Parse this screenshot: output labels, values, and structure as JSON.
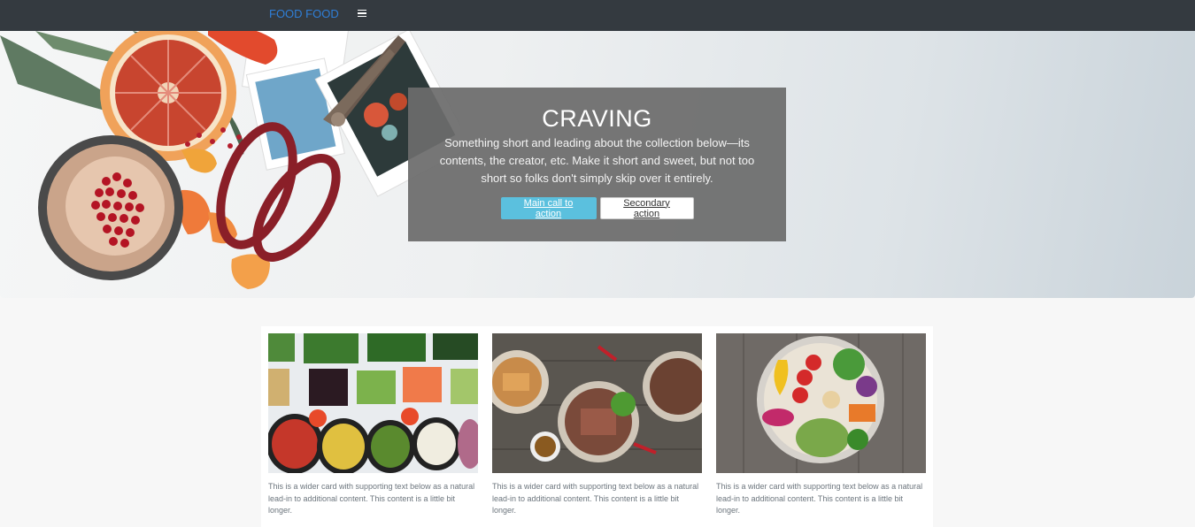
{
  "navbar": {
    "brand": "FOOD FOOD",
    "menu_icon": "hamburger-menu-icon",
    "background": "#343a40",
    "brand_color": "#2f7fd8"
  },
  "hero": {
    "title": "CRAVING",
    "lead": "Something short and leading about the collection below—its contents, the creator, etc. Make it short and sweet, but not too short so folks don't simply skip over it entirely.",
    "primary_button": "Main call to action",
    "secondary_button": "Secondary action",
    "primary_color": "#5bc0de"
  },
  "cards": [
    {
      "image": "salad-bar-photo",
      "text": "This is a wider card with supporting text below as a natural lead-in to additional content. This content is a little bit longer."
    },
    {
      "image": "steak-bowls-photo",
      "text": "This is a wider card with supporting text below as a natural lead-in to additional content. This content is a little bit longer."
    },
    {
      "image": "vegetable-bowl-photo",
      "text": "This is a wider card with supporting text below as a natural lead-in to additional content. This content is a little bit longer."
    }
  ]
}
